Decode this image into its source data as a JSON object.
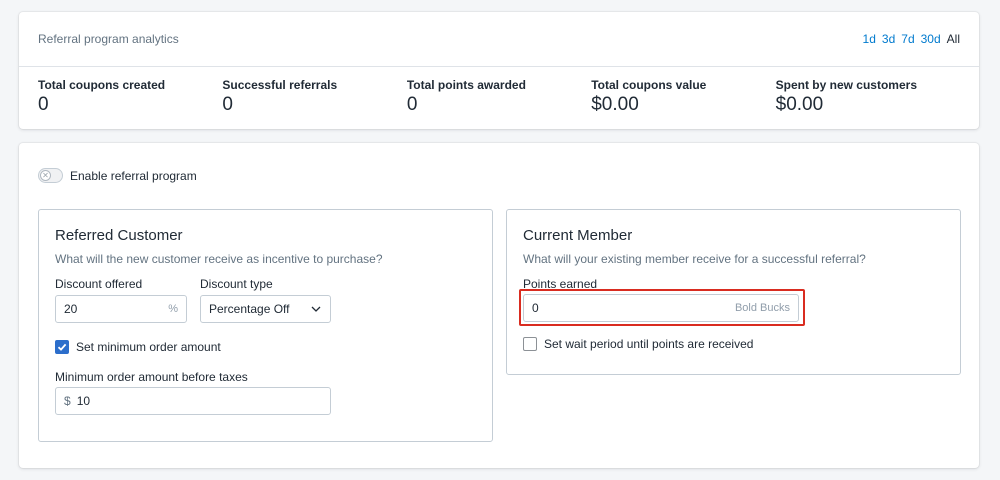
{
  "analytics": {
    "title": "Referral program analytics",
    "ranges": [
      {
        "label": "1d",
        "active": false
      },
      {
        "label": "3d",
        "active": false
      },
      {
        "label": "7d",
        "active": false
      },
      {
        "label": "30d",
        "active": false
      },
      {
        "label": "All",
        "active": true
      }
    ],
    "stats": [
      {
        "label": "Total coupons created",
        "value": "0"
      },
      {
        "label": "Successful referrals",
        "value": "0"
      },
      {
        "label": "Total points awarded",
        "value": "0"
      },
      {
        "label": "Total coupons value",
        "value": "$0.00"
      },
      {
        "label": "Spent by new customers",
        "value": "$0.00"
      }
    ]
  },
  "settings": {
    "enable_label": "Enable referral program",
    "enabled": false,
    "referred": {
      "title": "Referred Customer",
      "subtitle": "What will the new customer receive as incentive to purchase?",
      "discount_label": "Discount offered",
      "discount_value": "20",
      "discount_suffix": "%",
      "type_label": "Discount type",
      "type_value": "Percentage Off",
      "min_order_check_label": "Set minimum order amount",
      "min_order_checked": true,
      "min_order_label": "Minimum order amount before taxes",
      "min_order_prefix": "$",
      "min_order_value": "10"
    },
    "member": {
      "title": "Current Member",
      "subtitle": "What will your existing member receive for a successful referral?",
      "points_label": "Points earned",
      "points_value": "0",
      "points_suffix": "Bold Bucks",
      "wait_label": "Set wait period until points are received",
      "wait_checked": false
    }
  },
  "colors": {
    "accent": "#007ace",
    "checkbox": "#2c6ecb",
    "highlight": "#d92c20"
  }
}
